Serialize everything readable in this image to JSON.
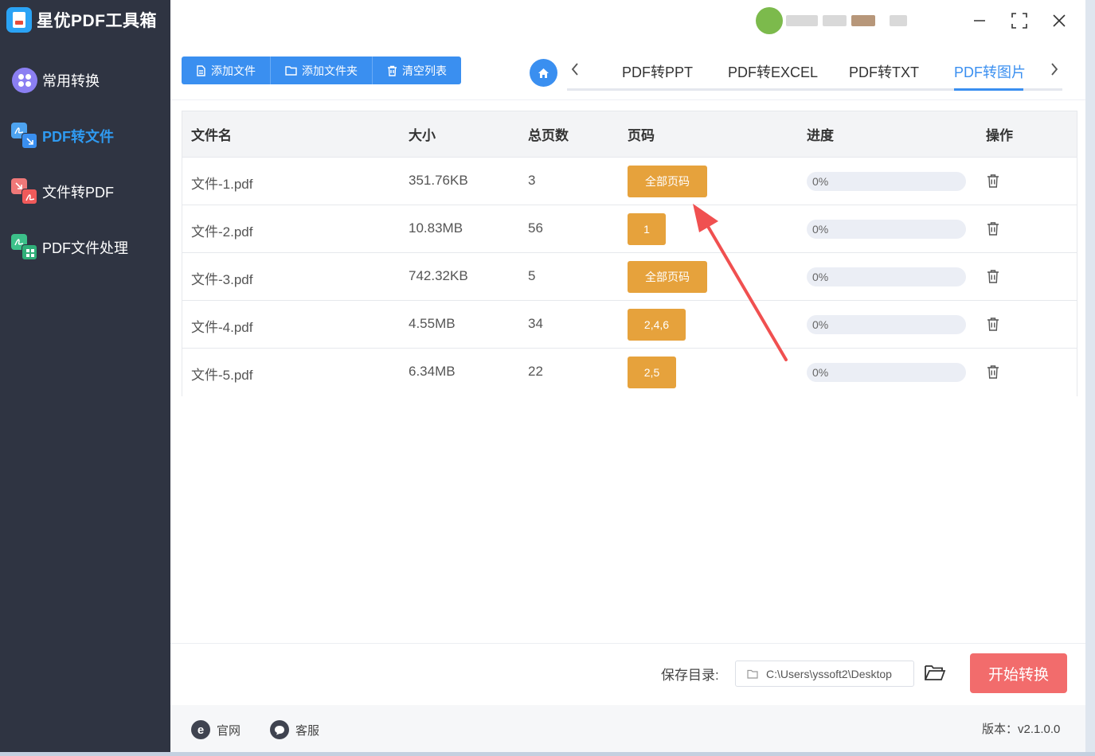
{
  "app": {
    "title": "星优PDF工具箱"
  },
  "sidebar": {
    "items": [
      {
        "label": "常用转换",
        "icon": "apps-icon",
        "active": false
      },
      {
        "label": "PDF转文件",
        "icon": "pdf-to-file-icon",
        "active": true
      },
      {
        "label": "文件转PDF",
        "icon": "file-to-pdf-icon",
        "active": false
      },
      {
        "label": "PDF文件处理",
        "icon": "pdf-process-icon",
        "active": false
      }
    ]
  },
  "toolbar": {
    "add_file": "添加文件",
    "add_folder": "添加文件夹",
    "clear_list": "清空列表"
  },
  "tabs": {
    "items": [
      "PDF转PPT",
      "PDF转EXCEL",
      "PDF转TXT",
      "PDF转图片"
    ],
    "active": "PDF转图片"
  },
  "table": {
    "headers": {
      "name": "文件名",
      "size": "大小",
      "pages": "总页数",
      "page_range": "页码",
      "progress": "进度",
      "action": "操作"
    },
    "rows": [
      {
        "name": "文件-1.pdf",
        "size": "351.76KB",
        "pages": "3",
        "page_range": "全部页码",
        "progress": 0,
        "progress_text": "0%"
      },
      {
        "name": "文件-2.pdf",
        "size": "10.83MB",
        "pages": "56",
        "page_range": "1",
        "progress": 0,
        "progress_text": "0%"
      },
      {
        "name": "文件-3.pdf",
        "size": "742.32KB",
        "pages": "5",
        "page_range": "全部页码",
        "progress": 0,
        "progress_text": "0%"
      },
      {
        "name": "文件-4.pdf",
        "size": "4.55MB",
        "pages": "34",
        "page_range": "2,4,6",
        "progress": 0,
        "progress_text": "0%"
      },
      {
        "name": "文件-5.pdf",
        "size": "6.34MB",
        "pages": "22",
        "page_range": "2,5",
        "progress": 0,
        "progress_text": "0%"
      }
    ]
  },
  "save": {
    "label": "保存目录:",
    "path": "C:\\Users\\yssoft2\\Desktop"
  },
  "start_button": "开始转换",
  "footer": {
    "website": "官网",
    "support": "客服",
    "version": "版本：v2.1.0.0"
  },
  "colors": {
    "sidebar_bg": "#2f3442",
    "accent": "#3a8ff0",
    "page_button": "#e6a23c",
    "start_button": "#f26c6c",
    "annotation_arrow": "#f05050"
  }
}
